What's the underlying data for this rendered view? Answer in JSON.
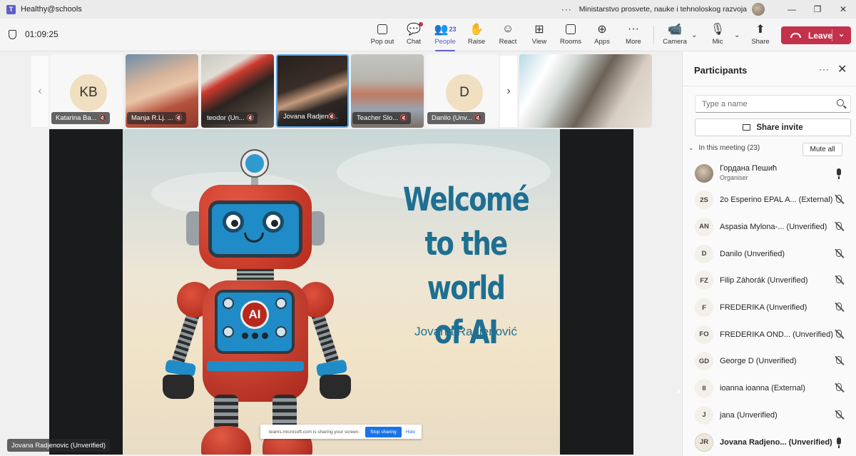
{
  "titlebar": {
    "app_title": "Healthy@schools",
    "org_name": "Ministarstvo prosvete, nauke i tehnoloskog razvoja"
  },
  "toolbar": {
    "timer": "01:09:25",
    "buttons": {
      "popout": "Pop out",
      "chat": "Chat",
      "people": "People",
      "people_count": "23",
      "raise": "Raise",
      "react": "React",
      "view": "View",
      "rooms": "Rooms",
      "apps": "Apps",
      "more": "More",
      "camera": "Camera",
      "mic": "Mic",
      "share": "Share",
      "leave": "Leave"
    }
  },
  "gallery": {
    "tiles": [
      {
        "name": "Katarina Ba...",
        "initials": "KB"
      },
      {
        "name": "Manja R.Lj. ..."
      },
      {
        "name": "teodor (Un..."
      },
      {
        "name": "Jovana Radjeno..."
      },
      {
        "name": "Teacher Slo..."
      },
      {
        "name": "Danilo (Unv...",
        "initials": "D"
      }
    ]
  },
  "slide": {
    "title_line1": "Welcomé",
    "title_line2": "to the world",
    "title_line3": "of AI",
    "author": "Jovana Radjenović",
    "robot_badge": "AI"
  },
  "share_notice": {
    "text": "teams.microsoft.com is sharing your screen.",
    "stop": "Stop sharing",
    "hide": "Hide"
  },
  "presenter_name": "Jovana Radjenovic (Unverified)",
  "panel": {
    "title": "Participants",
    "search_placeholder": "Type a name",
    "share_invite": "Share invite",
    "section_label": "In this meeting (23)",
    "mute_all": "Mute all",
    "participants": [
      {
        "initials": "",
        "name": "Гордана Пешић",
        "sub": "Organiser",
        "mic": "on"
      },
      {
        "initials": "2S",
        "name": "2o Esperino EPAL A... (External)",
        "mic": "off"
      },
      {
        "initials": "AN",
        "name": "Aspasia Mylona-... (Unverified)",
        "mic": "off"
      },
      {
        "initials": "D",
        "name": "Danilo (Unverified)",
        "mic": "off"
      },
      {
        "initials": "FZ",
        "name": "Filip Záhorák (Unverified)",
        "mic": "off"
      },
      {
        "initials": "F",
        "name": "FREDERIKA (Unverified)",
        "mic": "off"
      },
      {
        "initials": "FO",
        "name": "FREDERIKA OND... (Unverified)",
        "mic": "off"
      },
      {
        "initials": "GD",
        "name": "George D (Unverified)",
        "mic": "off"
      },
      {
        "initials": "II",
        "name": "ioanna ioanna (External)",
        "mic": "off"
      },
      {
        "initials": "J",
        "name": "jana (Unverified)",
        "mic": "off"
      },
      {
        "initials": "JR",
        "name": "Jovana Radjeno... (Unverified)",
        "mic": "on"
      }
    ]
  },
  "colors": {
    "accent": "#5b5fc7",
    "leave": "#c4314b",
    "slide_text": "#1e6f91"
  }
}
